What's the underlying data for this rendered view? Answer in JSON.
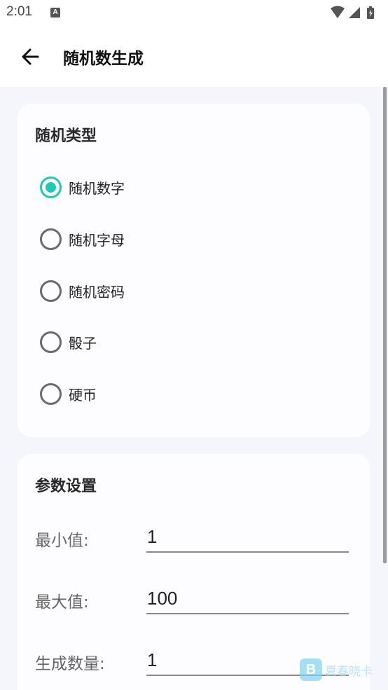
{
  "status_bar": {
    "time": "2:01",
    "notification_icon": "a-icon",
    "right_icons": [
      "wifi-icon",
      "signal-icon",
      "battery-icon"
    ]
  },
  "app_bar": {
    "back_icon": "arrow-left-icon",
    "title": "随机数生成"
  },
  "random_type": {
    "title": "随机类型",
    "options": [
      {
        "label": "随机数字",
        "checked": true
      },
      {
        "label": "随机字母",
        "checked": false
      },
      {
        "label": "随机密码",
        "checked": false
      },
      {
        "label": "骰子",
        "checked": false
      },
      {
        "label": "硬币",
        "checked": false
      }
    ]
  },
  "params": {
    "title": "参数设置",
    "min_label": "最小值:",
    "min_value": "1",
    "max_label": "最大值:",
    "max_value": "100",
    "count_label": "生成数量:",
    "count_value": "1"
  },
  "watermark": {
    "logo_letter": "B",
    "text": "夏春晓卡"
  },
  "colors": {
    "accent": "#20c9b5",
    "background": "#f4f6fb",
    "card": "#fdfdff"
  }
}
